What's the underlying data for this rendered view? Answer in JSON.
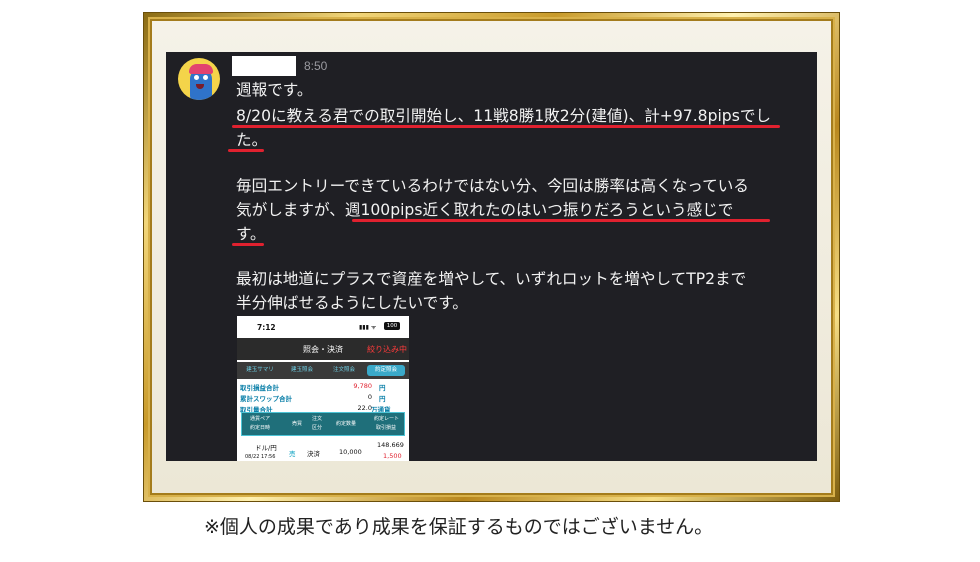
{
  "sender": {
    "time": "8:50"
  },
  "message": {
    "lines": [
      "週報です。",
      "8/20に教える君での取引開始し、11戦8勝1敗2分(建値)、計+97.8pipsでし",
      "た。",
      "",
      "毎回エントリーできているわけではない分、今回は勝率は高くなっている",
      "気がしますが、週100pips近く取れたのはいつ振りだろうという感じで",
      "す。",
      "",
      "最初は地道にプラスで資産を増やして、いずれロットを増やしてTP2まで",
      "半分伸ばせるようにしたいです。"
    ]
  },
  "phone": {
    "status_time": "7:12",
    "battery": "100",
    "header_title": "照会・決済",
    "header_filter": "絞り込み中",
    "tabs": [
      "建玉サマリ",
      "建玉照会",
      "注文照会",
      "約定照会"
    ],
    "summary": [
      {
        "label": "取引損益合計",
        "value": "9,780",
        "unit": "円",
        "value_color": "#e0212f"
      },
      {
        "label": "累計スワップ合計",
        "value": "0",
        "unit": "円",
        "value_color": "#111111"
      },
      {
        "label": "取引量合計",
        "value": "22.0",
        "unit": "万通貨",
        "value_color": "#111111"
      }
    ],
    "table_headers": {
      "pair": "通貨ペア",
      "date": "約定日時",
      "side": "売買",
      "order_type": "注文",
      "category": "区分",
      "qty": "約定数量",
      "rate": "約定レート",
      "pl": "取引損益"
    },
    "row": {
      "pair": "ドル/円",
      "date": "08/22 17:56",
      "side": "売",
      "type": "決済",
      "qty": "10,000",
      "rate": "148.669",
      "pl": "1,500"
    }
  },
  "disclaimer": "※個人の成果であり成果を保証するものではございません。"
}
